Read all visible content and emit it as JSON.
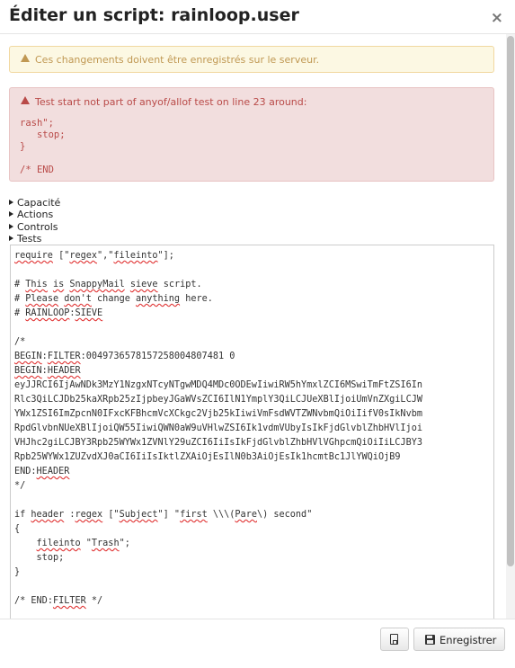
{
  "modal": {
    "title": "Éditer un script: rainloop.user",
    "close_glyph": "×"
  },
  "alerts": {
    "warning": "Ces changements doivent être enregistrés sur le serveur.",
    "error_title": "Test start not part of anyof/allof test on line 23 around:",
    "error_snippet": "rash\";\n   stop;\n}\n\n/* END"
  },
  "sections": [
    "Capacité",
    "Actions",
    "Controls",
    "Tests"
  ],
  "editor": {
    "lines": [
      "require [\"regex\",\"fileinto\"];",
      "",
      "# This is SnappyMail sieve script.",
      "# Please don't change anything here.",
      "# RAINLOOP:SIEVE",
      "",
      "/*",
      "BEGIN:FILTER:0049736578157258004807481 0",
      "BEGIN:HEADER",
      "eyJJRCI6IjAwNDk3MzY1NzgxNTcyNTgwMDQ4MDc0ODEwIiwiRW5hYmxlZCI6MSwiTmFtZSI6In",
      "Rlc3QiLCJDb25kaXRpb25zIjpbeyJGaWVsZCI6IlN1YmplY3QiLCJUeXBlIjoiUmVnZXgiLCJW",
      "YWx1ZSI6ImZpcnN0IFxcKFBhcmVcXCkgc2Vjb25kIiwiVmFsdWVTZWNvbmQiOiIifV0sIkNvbm",
      "RpdGlvbnNUeXBlIjoiQW55IiwiQWN0aW9uVHlwZSI6Ik1vdmVUbyIsIkFjdGlvblZhbHVlIjoi",
      "VHJhc2giLCJBY3Rpb25WYWx1ZVNlY29uZCI6IiIsIkFjdGlvblZhbHVlVGhpcmQiOiIiLCJBY3",
      "Rpb25WYWx1ZUZvdXJ0aCI6IiIsIktlZXAiOjEsIlN0b3AiOjEsIk1hcmtBc1JlYWQiOjB9",
      "END:HEADER",
      "*/",
      "",
      "if header :regex [\"Subject\"] \"first \\\\\\(Pare\\) second\"",
      "{",
      "    fileinto \"Trash\";",
      "    stop;",
      "}",
      "",
      "/* END:FILTER */"
    ]
  },
  "footer": {
    "save_label": "Enregistrer"
  }
}
